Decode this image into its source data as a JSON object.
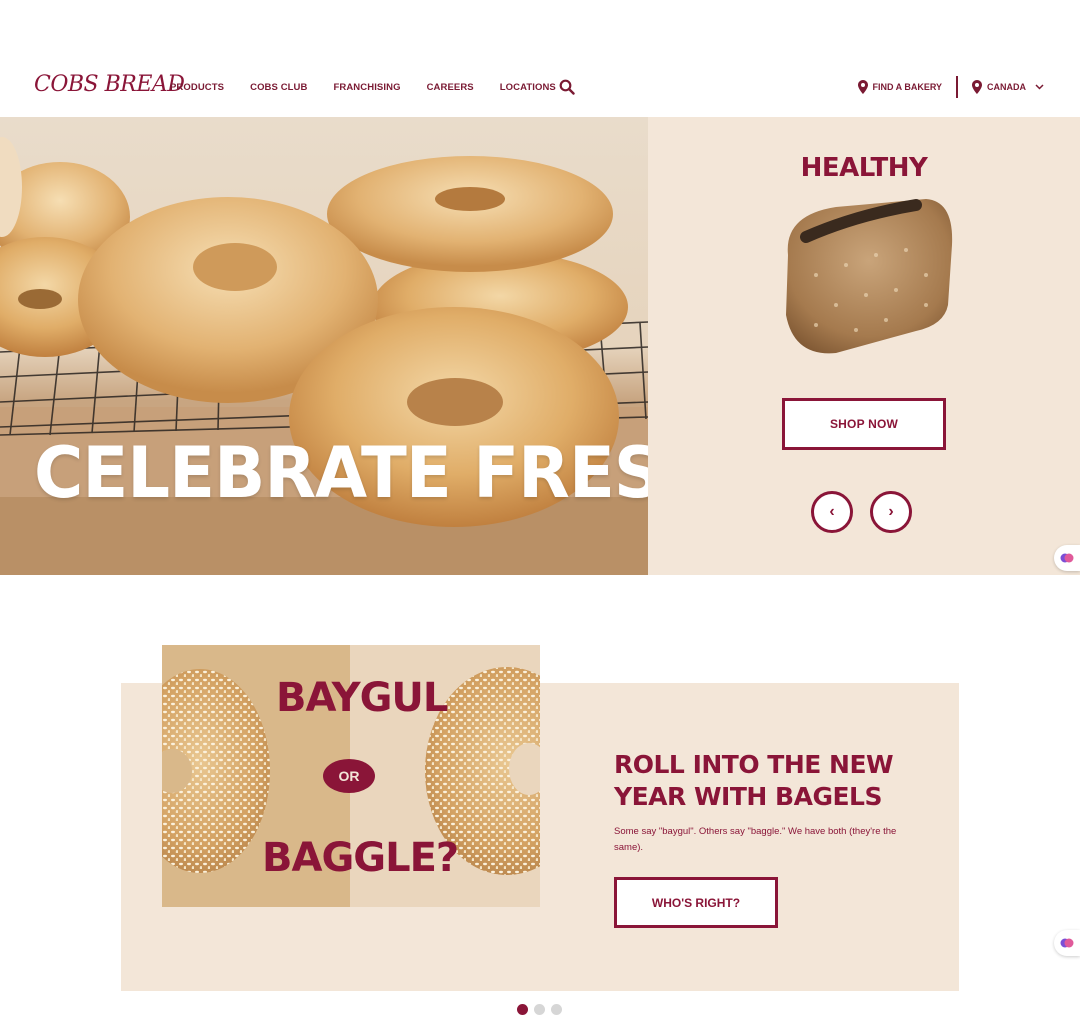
{
  "colors": {
    "brand": "#8a1538",
    "panel": "#f3e6d8",
    "white": "#ffffff"
  },
  "header": {
    "logo": "COBS BREAD",
    "nav": [
      {
        "label": "PRODUCTS"
      },
      {
        "label": "COBS CLUB"
      },
      {
        "label": "FRANCHISING"
      },
      {
        "label": "CAREERS"
      },
      {
        "label": "LOCATIONS"
      }
    ],
    "search_icon": "search-icon",
    "find_bakery": "FIND A BAKERY",
    "country": "CANADA"
  },
  "hero": {
    "title": "CELEBRATE FRESH",
    "panel_heading": "HEALTHY",
    "shop_button": "SHOP NOW",
    "prev_arrow": "‹",
    "next_arrow": "›"
  },
  "promo": {
    "image_word_1": "BAYGUL",
    "image_or": "OR",
    "image_word_2": "BAGGLE?",
    "title": "ROLL INTO THE NEW YEAR WITH BAGELS",
    "text": "Some say \"baygul\". Others say \"baggle.\" We have both (they're the same).",
    "button": "WHO'S RIGHT?",
    "carousel": {
      "slides": 3,
      "active": 1
    }
  }
}
